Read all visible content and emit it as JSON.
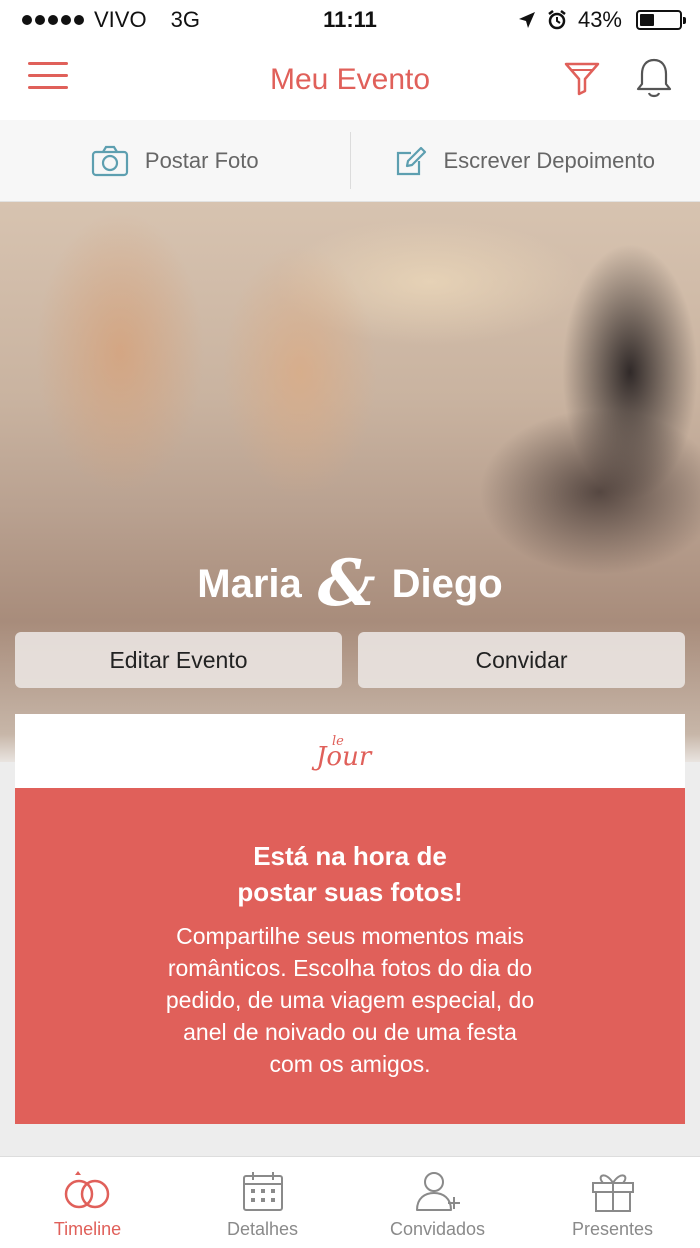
{
  "status_bar": {
    "carrier": "VIVO",
    "network": "3G",
    "time": "11:11",
    "battery": "43%",
    "battery_level": 0.43
  },
  "nav": {
    "title": "Meu Evento",
    "menu_icon": "hamburger-menu-icon",
    "filter_icon": "filter-icon",
    "bell_icon": "bell-icon"
  },
  "actions": {
    "post_photo": "Postar Foto",
    "write_testimonial": "Escrever Depoimento"
  },
  "hero": {
    "name_1": "Maria",
    "ampersand": "&",
    "name_2": "Diego",
    "edit_button": "Editar Evento",
    "invite_button": "Convidar"
  },
  "card": {
    "logo": "le jour",
    "heading_line1": "Está na hora de",
    "heading_line2": "postar suas fotos!",
    "text_line1": "Compartilhe seus momentos mais",
    "text_line2": "românticos. Escolha fotos do dia do",
    "text_line3": "pedido, de uma viagem especial, do",
    "text_line4": "anel de noivado ou de uma festa",
    "text_line5": "com os amigos."
  },
  "tabs": [
    {
      "label": "Timeline",
      "icon": "rings-icon",
      "active": true
    },
    {
      "label": "Detalhes",
      "icon": "calendar-icon",
      "active": false
    },
    {
      "label": "Convidados",
      "icon": "add-user-icon",
      "active": false
    },
    {
      "label": "Presentes",
      "icon": "gift-icon",
      "active": false
    }
  ],
  "colors": {
    "accent": "#e0605a",
    "tab_inactive": "#8a8a8a"
  }
}
